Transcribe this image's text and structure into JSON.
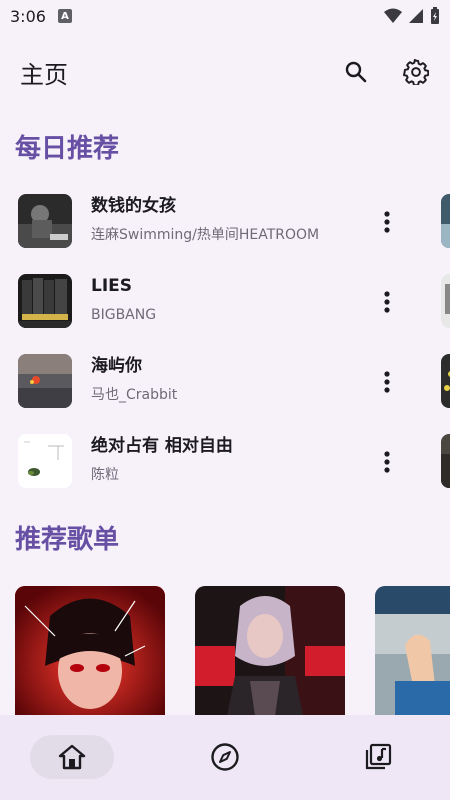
{
  "status": {
    "time": "3:06",
    "notification_badge": "A"
  },
  "top_bar": {
    "title": "主页",
    "search_icon": "search-icon",
    "settings_icon": "gear-icon"
  },
  "daily": {
    "title": "每日推荐",
    "songs": [
      {
        "title": "数钱的女孩",
        "artist": "连麻Swimming/热单间HEATROOM"
      },
      {
        "title": "LIES",
        "artist": "BIGBANG"
      },
      {
        "title": "海屿你",
        "artist": "马也_Crabbit"
      },
      {
        "title": "绝对占有 相对自由",
        "artist": "陈粒"
      }
    ]
  },
  "playlists": {
    "title": "推荐歌单"
  },
  "nav": {
    "home_icon": "home-icon",
    "discover_icon": "compass-icon",
    "library_icon": "music-library-icon"
  },
  "colors": {
    "accent": "#6750a4",
    "background": "#f7f2fa",
    "nav_bg": "#efe7f5",
    "nav_active": "#e2dbe8"
  }
}
